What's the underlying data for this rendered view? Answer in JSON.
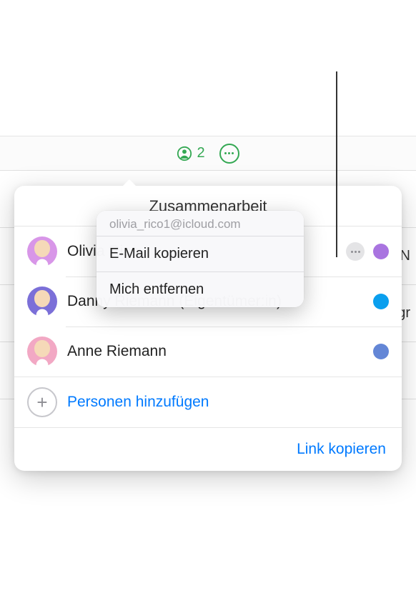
{
  "toolbar": {
    "collaborator_count": "2"
  },
  "popover": {
    "title": "Zusammenarbeit",
    "participants": [
      {
        "name": "Olivia Rico",
        "color": "purple",
        "has_more": true
      },
      {
        "name": "Danny Riemann (Eigentümer:in)",
        "color": "blue",
        "has_more": false
      },
      {
        "name": "Anne Riemann",
        "color": "slate",
        "has_more": false
      }
    ],
    "add_label": "Personen hinzufügen",
    "link_copy_label": "Link kopieren"
  },
  "context_menu": {
    "email": "olivia_rico1@icloud.com",
    "items": [
      "E-Mail kopieren",
      "Mich entfernen"
    ]
  },
  "background": {
    "row1_trailing": "t N",
    "row2_trailing": "gr"
  }
}
